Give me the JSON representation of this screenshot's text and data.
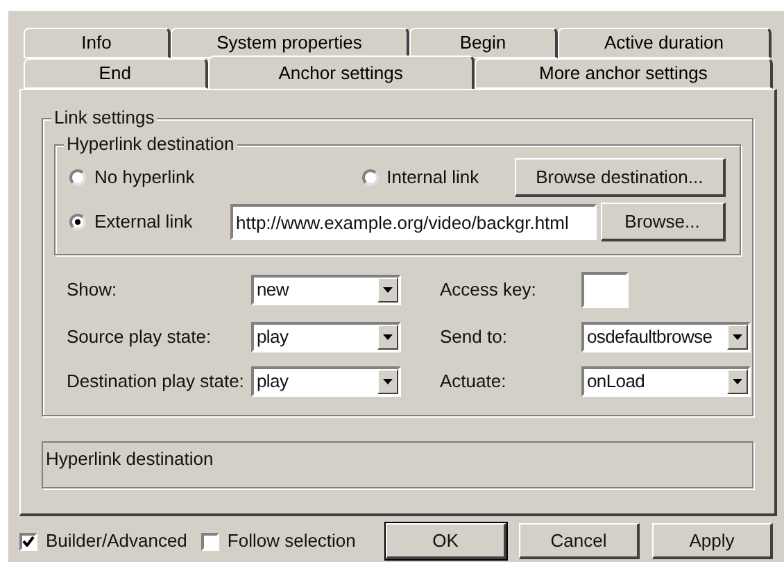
{
  "tabs_row_1": [
    {
      "label": "Info",
      "selected": false
    },
    {
      "label": "System properties",
      "selected": false
    },
    {
      "label": "Begin",
      "selected": false
    },
    {
      "label": "Active duration",
      "selected": false
    }
  ],
  "tabs_row_2": [
    {
      "label": "End",
      "selected": false
    },
    {
      "label": "Anchor settings",
      "selected": true
    },
    {
      "label": "More anchor settings",
      "selected": false
    }
  ],
  "link_settings": {
    "title": "Link settings",
    "hyperlink_destination": {
      "title": "Hyperlink destination",
      "options": [
        {
          "label": "No hyperlink",
          "selected": false
        },
        {
          "label": "Internal link",
          "selected": false
        },
        {
          "label": "External link",
          "selected": true
        }
      ],
      "browse_destination_button": "Browse destination...",
      "url": "http://www.example.org/video/backgr.html",
      "browse_button": "Browse..."
    },
    "fields": [
      {
        "label": "Show:",
        "value": "new",
        "kind": "dropdown"
      },
      {
        "label": "Access key:",
        "kind": "text"
      },
      {
        "label": "Source play state:",
        "value": "play",
        "kind": "dropdown"
      },
      {
        "label": "Send to:",
        "value": "osdefaultbrowse",
        "kind": "dropdown"
      },
      {
        "label": "Destination play state:",
        "value": "play",
        "kind": "dropdown"
      },
      {
        "label": "Actuate:",
        "value": "onLoad",
        "kind": "dropdown"
      }
    ]
  },
  "description": "Hyperlink destination",
  "checkboxes": [
    {
      "label": "Builder/Advanced",
      "checked": true
    },
    {
      "label": "Follow selection",
      "checked": false
    }
  ],
  "buttons": [
    {
      "label": "OK",
      "default": true
    },
    {
      "label": "Cancel",
      "default": false
    },
    {
      "label": "Apply",
      "default": false
    }
  ]
}
